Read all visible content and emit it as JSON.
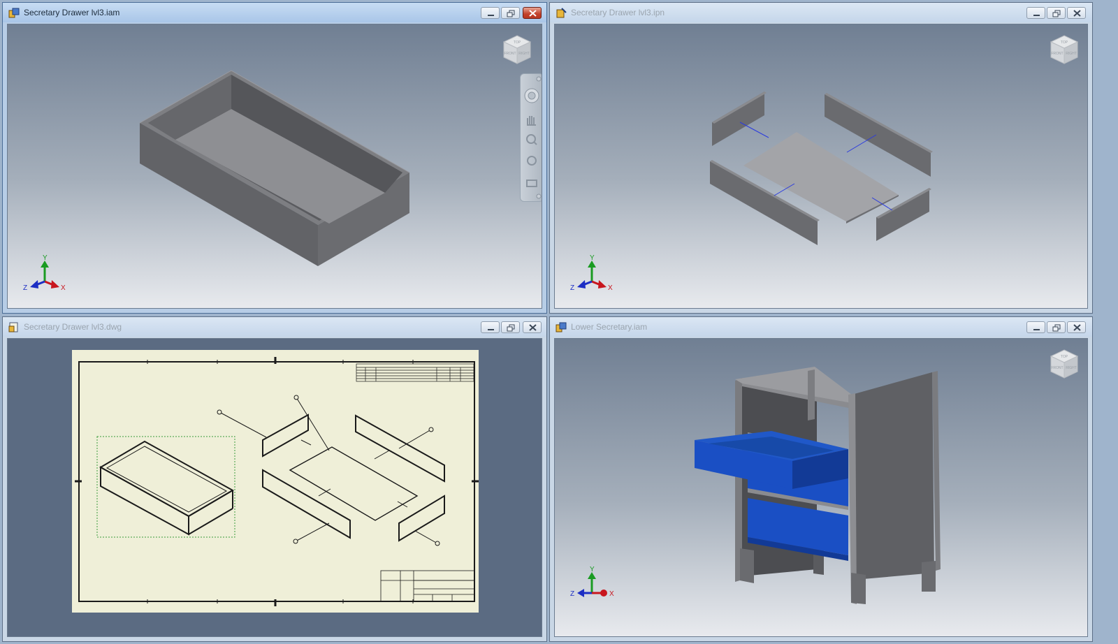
{
  "windows": [
    {
      "id": "top-left",
      "title": "Secretary Drawer lvl3.iam",
      "active": true,
      "content": "drawer-assembly"
    },
    {
      "id": "top-right",
      "title": "Secretary Drawer lvl3.ipn",
      "active": false,
      "content": "exploded-presentation"
    },
    {
      "id": "bottom-left",
      "title": "Secretary Drawer lvl3.dwg",
      "active": false,
      "content": "drawing-sheet"
    },
    {
      "id": "bottom-right",
      "title": "Lower Secretary.iam",
      "active": false,
      "content": "cabinet-assembly"
    }
  ],
  "window_controls": {
    "minimize_icon": "minimize-icon",
    "maximize_icon": "maximize-icon",
    "close_icon": "close-icon"
  },
  "viewcube": {
    "faces": {
      "top": "TOP",
      "front": "FRONT",
      "right": "RIGHT"
    }
  },
  "triad": {
    "x_label": "X",
    "y_label": "Y",
    "z_label": "Z"
  },
  "navigation_bar": {
    "tools": [
      "steering-wheel-icon",
      "pan-hand-icon",
      "zoom-icon",
      "orbit-icon",
      "look-at-icon"
    ]
  },
  "colors": {
    "viewport_top": "#707f93",
    "viewport_bottom": "#e8eaee",
    "part_gray": "#6e6f73",
    "drawer_blue": "#1a4fc4",
    "sheet_paper": "#efefd8",
    "axis_x": "#c8161e",
    "axis_y": "#1a9b22",
    "axis_z": "#1c2ec4"
  }
}
